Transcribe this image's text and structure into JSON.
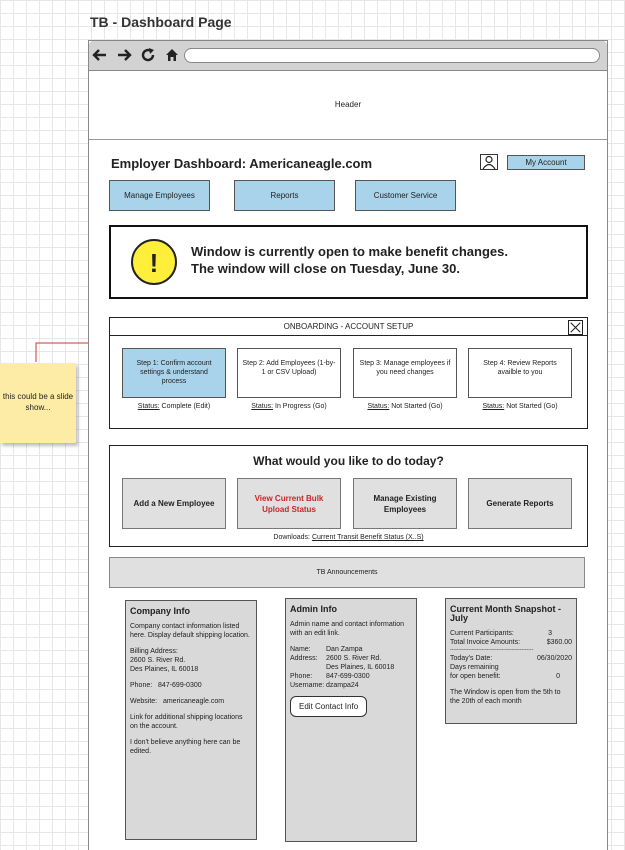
{
  "page_title": "TB - Dashboard Page",
  "header_label": "Header",
  "dashboard": {
    "title": "Employer Dashboard: Americaneagle.com",
    "my_account_label": "My Account"
  },
  "nav": {
    "manage_employees": "Manage Employees",
    "reports": "Reports",
    "customer_service": "Customer Service"
  },
  "alert": {
    "icon": "!",
    "line1": "Window is currently open to make benefit changes.",
    "line2": "The window will close on Tuesday, June 30."
  },
  "onboarding": {
    "title": "ONBOARDING - ACCOUNT SETUP",
    "steps": [
      {
        "label": "Step 1: Confirm account settings & understand process",
        "status_label": "Status:",
        "status": "Complete (Edit)"
      },
      {
        "label": "Step 2: Add Employees (1-by-1 or CSV Upload)",
        "status_label": "Status:",
        "status": "In Progress (Go)"
      },
      {
        "label": "Step 3: Manage employees if you need changes",
        "status_label": "Status:",
        "status": "Not Started (Go)"
      },
      {
        "label": "Step 4: Review Reports availble to you",
        "status_label": "Status:",
        "status": "Not Started (Go)"
      }
    ]
  },
  "todo": {
    "title": "What would you like to do today?",
    "actions": [
      "Add a New Employee",
      "View Current Bulk Upload Status",
      "Manage Existing Employees",
      "Generate Reports"
    ],
    "downloads_label": "Downloads:",
    "downloads_link": "Current Transit Benefit Status (X..S)"
  },
  "announcements_label": "TB Announcements",
  "company_info": {
    "title": "Company Info",
    "description": "Company contact information listed here. Display default shipping location.",
    "billing_label": "Billing Address:",
    "billing_line1": "2600 S. River Rd.",
    "billing_line2": "Des Plaines, IL 60018",
    "phone_label": "Phone:",
    "phone": "847-699-0300",
    "website_label": "Website:",
    "website": "americaneagle.com",
    "shipping_note": "Link for additional shipping locations on the account.",
    "edit_note": "I don't believe anything here can be edited."
  },
  "admin_info": {
    "title": "Admin Info",
    "description": "Admin name and contact information with an edit link.",
    "name_label": "Name:",
    "name": "Dan Zampa",
    "address_label": "Address:",
    "address_line1": "2600 S. River Rd.",
    "address_line2": "Des Plaines, IL 60018",
    "phone_label": "Phone:",
    "phone": "847-699-0300",
    "username_label": "Username:",
    "username": "dzampa24",
    "edit_button": "Edit Contact Info"
  },
  "snapshot": {
    "title": "Current Month Snapshot - July",
    "participants_label": "Current Participants:",
    "participants": "3",
    "invoice_label": "Total Invoice Amounts:",
    "invoice": "$360.00",
    "divider": "--------------------------------------------------",
    "date_label": "Today's Date:",
    "date": "06/30/2020",
    "days_label_1": "Days remaining",
    "days_label_2": "for open benefit:",
    "days": "0",
    "window_note": "The Window is open from the 5th to the 20th of each month"
  },
  "sticky_note": "this could be a slide show..."
}
